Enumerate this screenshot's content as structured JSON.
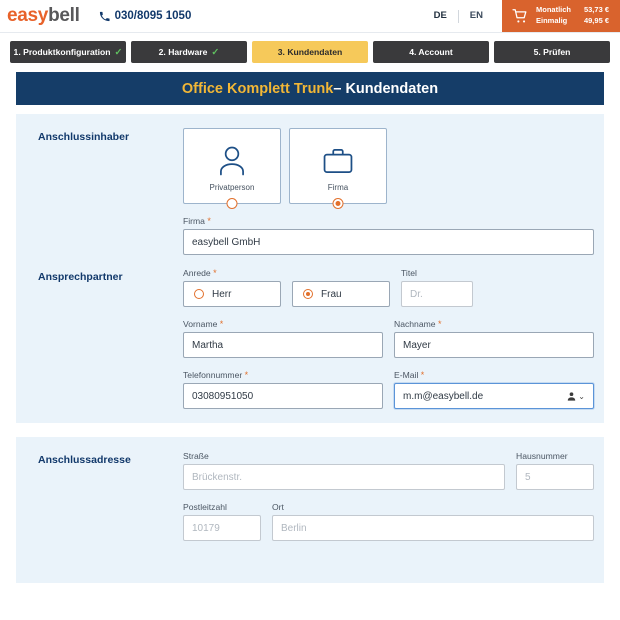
{
  "header": {
    "brand_easy": "easy",
    "brand_bell": "bell",
    "phone": "030/8095 1050",
    "lang_de": "DE",
    "lang_en": "EN",
    "cart": {
      "monthly_label": "Monatlich",
      "monthly_value": "53,73 €",
      "once_label": "Einmalig",
      "once_value": "49,95 €"
    },
    "colors": {
      "brand_orange": "#e8622a",
      "cart_bg": "#d9632d",
      "navy": "#12396b"
    }
  },
  "steps": [
    {
      "label": "1. Produktkonfiguration",
      "done": "✓",
      "active": false
    },
    {
      "label": "2. Hardware",
      "done": "✓",
      "active": false
    },
    {
      "label": "3. Kundendaten",
      "done": "",
      "active": true
    },
    {
      "label": "4. Account",
      "done": "",
      "active": false
    },
    {
      "label": "5. Prüfen",
      "done": "",
      "active": false
    }
  ],
  "banner": {
    "product": "Office Komplett Trunk",
    "separator_and_section": " – Kundendaten",
    "bg": "#153d68",
    "product_color": "#f2b736"
  },
  "anschlussinhaber": {
    "section_label": "Anschlussinhaber",
    "cards": [
      {
        "label": "Privatperson",
        "icon": "person-icon",
        "selected": false
      },
      {
        "label": "Firma",
        "icon": "briefcase-icon",
        "selected": true
      }
    ],
    "firma": {
      "label": "Firma",
      "required": "*",
      "value": "easybell GmbH"
    }
  },
  "ansprechpartner": {
    "section_label": "Ansprechpartner",
    "anrede": {
      "label": "Anrede",
      "required": "*",
      "options": [
        {
          "label": "Herr",
          "selected": false
        },
        {
          "label": "Frau",
          "selected": true
        }
      ]
    },
    "titel": {
      "label": "Titel",
      "required": "",
      "placeholder": "Dr.",
      "value": ""
    },
    "vorname": {
      "label": "Vorname",
      "required": "*",
      "value": "Martha"
    },
    "nachname": {
      "label": "Nachname",
      "required": "*",
      "value": "Mayer"
    },
    "telefonnummer": {
      "label": "Telefonnummer",
      "required": "*",
      "value": "03080951050"
    },
    "email": {
      "label": "E-Mail",
      "required": "*",
      "value": "m.m@easybell.de",
      "focused": true,
      "autofill_icon": "contact-autofill-icon",
      "chevron": "⌄"
    }
  },
  "anschlussadresse": {
    "section_label": "Anschlussadresse",
    "strasse": {
      "label": "Straße",
      "required": "",
      "placeholder": "Brückenstr.",
      "value": ""
    },
    "hausnummer": {
      "label": "Hausnummer",
      "required": "",
      "placeholder": "5",
      "value": ""
    },
    "postleitzahl": {
      "label": "Postleitzahl",
      "required": "",
      "placeholder": "10179",
      "value": ""
    },
    "ort": {
      "label": "Ort",
      "required": "",
      "placeholder": "Berlin",
      "value": ""
    }
  }
}
